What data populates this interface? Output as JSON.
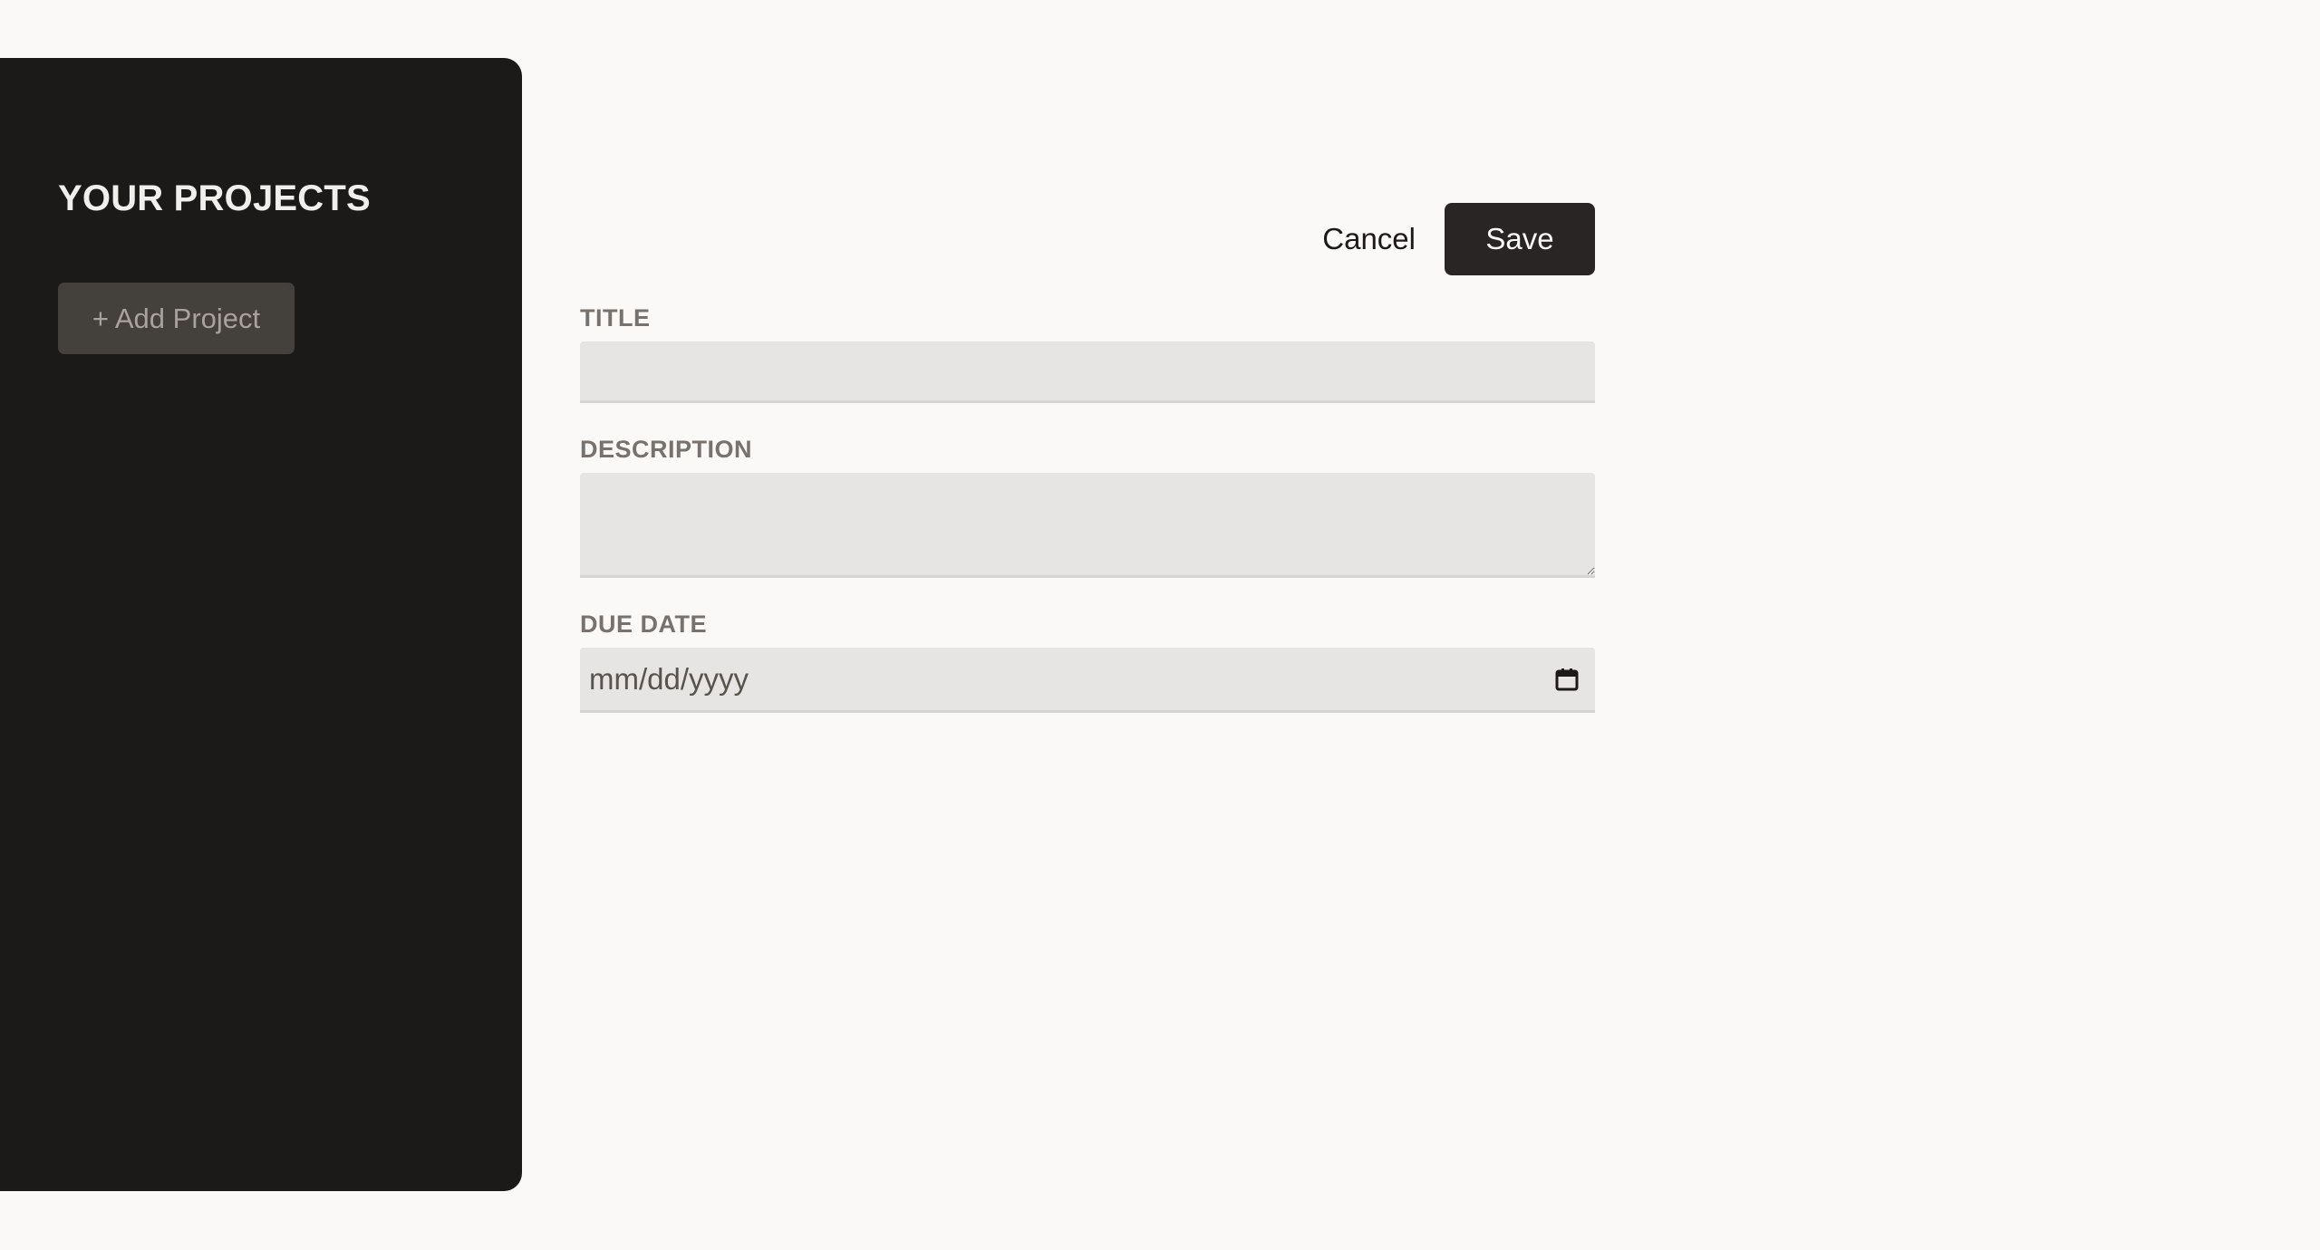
{
  "sidebar": {
    "title": "YOUR PROJECTS",
    "add_project_label": "+ Add Project"
  },
  "form": {
    "actions": {
      "cancel_label": "Cancel",
      "save_label": "Save"
    },
    "fields": {
      "title": {
        "label": "TITLE",
        "value": ""
      },
      "description": {
        "label": "DESCRIPTION",
        "value": ""
      },
      "due_date": {
        "label": "DUE DATE",
        "placeholder": "mm/dd/yyyy",
        "icon": "calendar-icon"
      }
    }
  }
}
